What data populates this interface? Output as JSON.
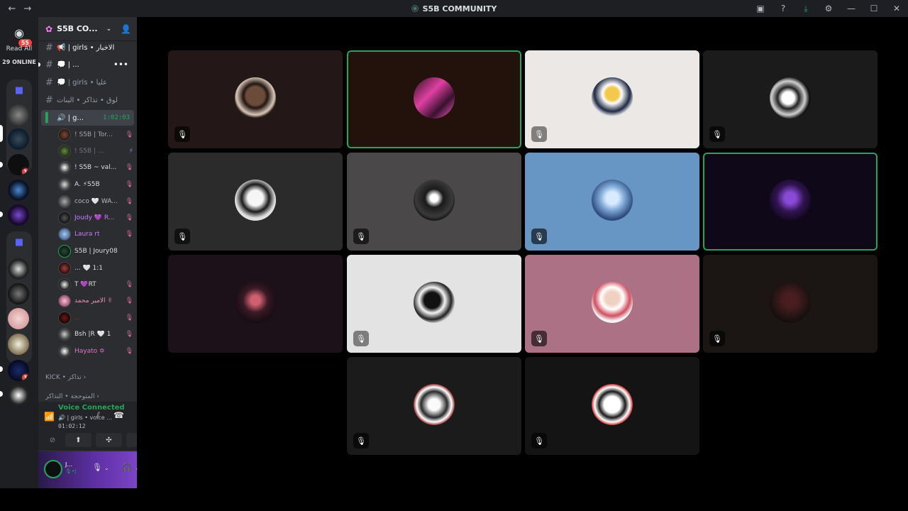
{
  "titlebar": {
    "title": "S5B COMMUNITY",
    "back": "←",
    "forward": "→"
  },
  "rail": {
    "dm_badge": "55",
    "read_all": "Read All",
    "online": "29 ONLINE",
    "servers": [
      {
        "badge": ""
      },
      {
        "badge": ""
      },
      {
        "badge": "1"
      },
      {
        "badge": ""
      },
      {
        "badge": ""
      },
      {
        "badge": ""
      },
      {
        "badge": ""
      },
      {
        "badge": ""
      },
      {
        "badge": ""
      },
      {
        "badge": "1"
      },
      {
        "badge": ""
      }
    ]
  },
  "sidebar": {
    "server_name": "S5B CO...",
    "channels": [
      {
        "label": "📢 | girls • الاخبار"
      },
      {
        "label": "💭 | ..."
      },
      {
        "label": "💭 | girls • عليا"
      },
      {
        "label": "لوق • تذاكر • البنات"
      },
      {
        "label": "🔊 | g...",
        "timer": "1:02:03"
      }
    ],
    "members": [
      {
        "name": "! S5B | Tor...",
        "color": "#a0a6ad",
        "status": "🎙"
      },
      {
        "name": "! S5B | ...",
        "color": "#72767d",
        "status": "⚡"
      },
      {
        "name": "! S5B ~ val...",
        "color": "#dbdee1",
        "status": "🎙"
      },
      {
        "name": "A. ⚡S5B",
        "color": "#dbdee1",
        "status": "🎙"
      },
      {
        "name": "coco 🤍 WA...",
        "color": "#b5bac1",
        "status": "🎙"
      },
      {
        "name": "Joudy 💜 R...",
        "color": "#c77dff",
        "status": "🎙"
      },
      {
        "name": "Laura rt",
        "color": "#c77dff",
        "status": "🎙"
      },
      {
        "name": "S5B | Joury08",
        "color": "#dbdee1",
        "status": ""
      },
      {
        "name": "... 🤍 1:1",
        "color": "#dbdee1",
        "status": ""
      },
      {
        "name": "T 💜RT",
        "color": "#dbdee1",
        "status": "🎙"
      },
      {
        "name": "الامير محمد ✌",
        "color": "#f48fb1",
        "status": "🎙"
      },
      {
        "name": "...",
        "color": "#c62828",
        "status": "🎙"
      },
      {
        "name": "Bsh |R 🤍 1",
        "color": "#dbdee1",
        "status": "🎙"
      },
      {
        "name": "Hayato ✡",
        "color": "#e573c8",
        "status": "🎙"
      }
    ],
    "categories": [
      "KICK • تذاكر",
      "المتوحجة • التذاكر"
    ]
  },
  "voice": {
    "title": "Voice Connected",
    "channel": "🔊 | girls • voice ...",
    "time": "01:02:12"
  },
  "user": {
    "name": "J...",
    "status": "🎙•|"
  },
  "tiles": [
    {
      "bg": "#231817",
      "avatar": "radial-gradient(circle at 50% 45%, #6b4b3a 0 30%, #201510 40%, #d9c8b8 62%, #2a1c16 72%)",
      "speaking": false,
      "light": false
    },
    {
      "bg": "#23120b",
      "avatar": "linear-gradient(135deg, #2a1020 0, #e040a0 40%, #3a1030 70%, #ff60c0 100%)",
      "speaking": true,
      "light": false
    },
    {
      "bg": "#ebe8e6",
      "avatar": "radial-gradient(circle at 50% 40%, #f2c94c 0 20%, #ffffff 30%, #1f2a44 55%, #e8e8e8 70%)",
      "speaking": false,
      "light": true
    },
    {
      "bg": "#1c1b1b",
      "avatar": "radial-gradient(circle at 45% 50%, #ffffff 0 20%, #222 35%, #cfcfcf 55%, #111 70%)",
      "speaking": false,
      "light": false
    },
    {
      "bg": "#2b2b2b",
      "avatar": "radial-gradient(circle at 50% 45%, #f5f5f5 0 25%, #1a1a1a 45%, #e0e0e0 65%)",
      "speaking": false,
      "light": false
    },
    {
      "bg": "#4a4849",
      "avatar": "radial-gradient(circle at 50% 45%, #ffffff 0 12%, #1a1a1a 30%, #3a3a3a 60%, #111 75%)",
      "speaking": false,
      "light": false
    },
    {
      "bg": "#6795c4",
      "avatar": "radial-gradient(circle at 50% 45%, #d8eaff 0 20%, #7fa9d6 40%, #2b4a7a 70%)",
      "speaking": false,
      "light": false
    },
    {
      "bg": "#0e0818",
      "avatar": "radial-gradient(circle at 50% 45%, #8a4ad8 0 18%, #301450 45%, #120820 75%)",
      "speaking": true,
      "light": false
    },
    {
      "bg": "#1d1119",
      "avatar": "radial-gradient(circle at 50% 45%, #d06070 0 15%, #3a1a24 40%, #140a10 75%)",
      "speaking": false,
      "light": false
    },
    {
      "bg": "#e4e3e3",
      "avatar": "radial-gradient(circle at 45% 45%, #111 0 25%, #f5f5f5 40%, #222 60%, #ffffff 75%)",
      "speaking": false,
      "light": true
    },
    {
      "bg": "#ad7186",
      "avatar": "radial-gradient(circle at 50% 40%, #f0d0c0 0 20%, #ffffff 35%, #d05060 55%, #f3f3f3 70%)",
      "speaking": false,
      "light": false
    },
    {
      "bg": "#1b1514",
      "avatar": "radial-gradient(circle at 50% 45%, #4a1e20 0 20%, #2a1616 50%, #120c0c 75%)",
      "speaking": false,
      "light": false
    },
    {
      "bg": "#1b1b1b",
      "avatar": "radial-gradient(circle at 50% 50%, #fafafa 0 20%, #2a2a2a 45%, #ffffff 60%, #8a1a1a 72%)",
      "speaking": false,
      "light": false
    },
    {
      "bg": "#141414",
      "avatar": "radial-gradient(circle at 50% 50%, #ffffff 0 28%, #1a1a1a 45%, #ffffff 60%, #c01818 72%)",
      "speaking": false,
      "light": false
    }
  ]
}
